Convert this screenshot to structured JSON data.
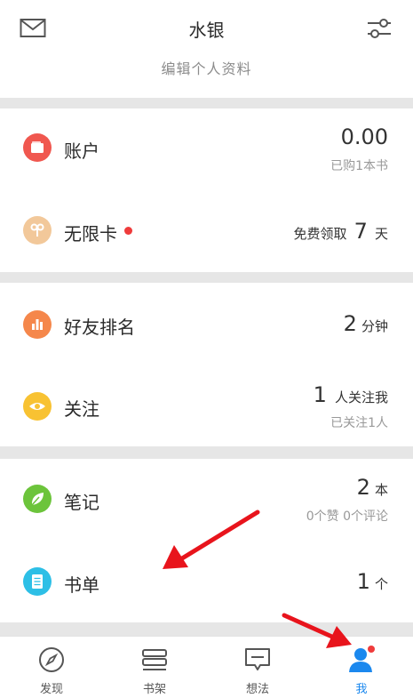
{
  "header": {
    "title": "水银",
    "mail_icon": "mail-icon",
    "filter_icon": "filter-sliders-icon"
  },
  "profile": {
    "edit_link": "编辑个人资料"
  },
  "account": {
    "label": "账户",
    "balance": "0.00",
    "purchased": "已购1本书",
    "icon": "wallet-icon",
    "color": "#f0574f"
  },
  "unlimited": {
    "label": "无限卡",
    "prefix": "免费领取",
    "days": "7",
    "suffix": "天",
    "icon": "card-icon",
    "color": "#f2c89a",
    "badge_color": "#ef3b3b"
  },
  "ranking": {
    "label": "好友排名",
    "value": "2",
    "unit": "分钟",
    "icon": "bar-chart-icon",
    "color": "#f5874b"
  },
  "follow": {
    "label": "关注",
    "count": "1",
    "count_text": "人关注我",
    "following": "已关注1人",
    "icon": "eye-icon",
    "color": "#f8c232"
  },
  "notes": {
    "label": "笔记",
    "count": "2",
    "unit": "本",
    "stats": "0个赞 0个评论",
    "icon": "leaf-icon",
    "color": "#6cc43b"
  },
  "booklist": {
    "label": "书单",
    "count": "1",
    "unit": "个",
    "icon": "list-icon",
    "color": "#2dbfe6"
  },
  "tabs": [
    {
      "label": "发现",
      "icon": "compass-icon",
      "active": false
    },
    {
      "label": "书架",
      "icon": "bookshelf-icon",
      "active": false
    },
    {
      "label": "想法",
      "icon": "comment-icon",
      "active": false
    },
    {
      "label": "我",
      "icon": "person-icon",
      "active": true
    }
  ],
  "accent_color": "#1b88ee",
  "annotation_color": "#e8141c"
}
